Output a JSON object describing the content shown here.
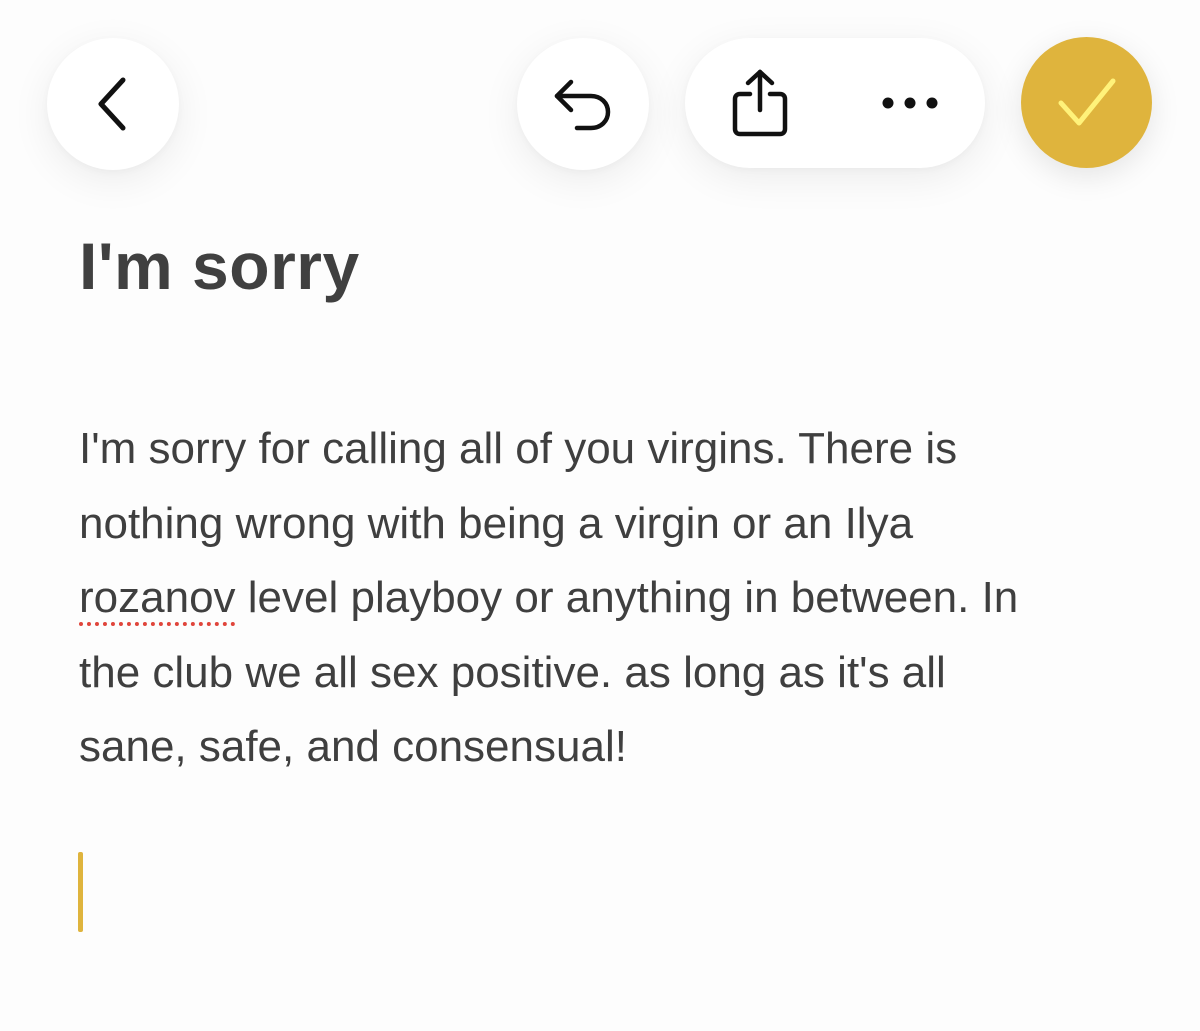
{
  "toolbar": {
    "back": {
      "icon": "chevron-left-icon"
    },
    "undo": {
      "icon": "undo-icon"
    },
    "share": {
      "icon": "share-icon"
    },
    "more": {
      "icon": "more-icon"
    },
    "done": {
      "icon": "checkmark-icon"
    }
  },
  "note": {
    "title": "I'm sorry",
    "body_part1": "I'm sorry for calling all of you virgins. There is\nnothing wrong with being a virgin or an Ilya\n",
    "misspelled_word": "rozanov",
    "body_part2": " level playboy or anything in between. In\nthe club we all sex positive. as long as it's all\nsane, safe, and consensual!"
  },
  "colors": {
    "accent": "#dfb43d",
    "text": "#3f3f3f",
    "spellcheck": "#e0453b",
    "checkmark": "#fff27a"
  }
}
